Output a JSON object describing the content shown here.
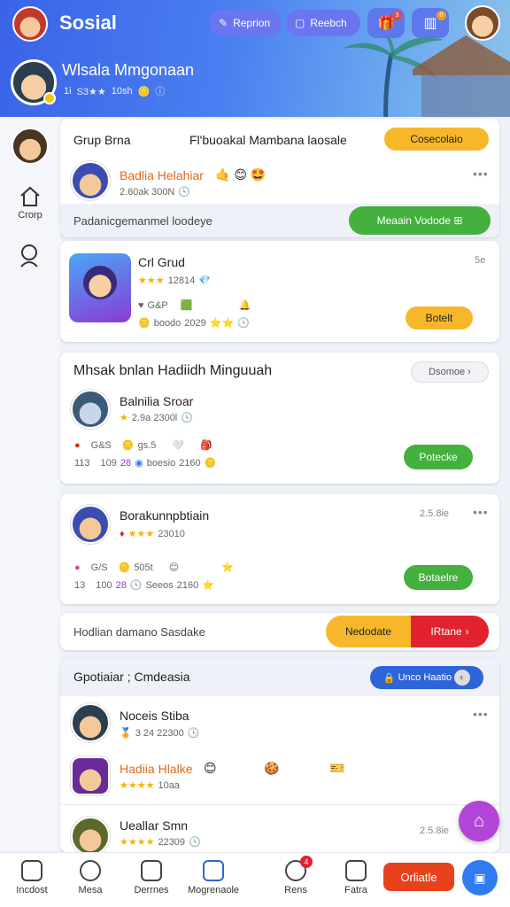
{
  "header": {
    "title": "Sosial",
    "pill_a": "Reprion",
    "pill_b": "Reebch",
    "badge_1": "3",
    "badge_2": "0",
    "profile_name": "Wlsala Mmgonaan",
    "profile_level": "1i",
    "profile_stats": "S3★★",
    "profile_points": "10sh"
  },
  "sidebar": {
    "home_label": "Crorp"
  },
  "card1": {
    "group_label": "Grup Brna",
    "description": "Fl'buoakal Mambana laosale",
    "action": "Cosecolaio",
    "user_name": "Badlia Helahiar",
    "user_meta": "2.60ak 300N",
    "footer_text": "Padanicgemanmel loodeye",
    "footer_button": "Meaain Vodode"
  },
  "card2": {
    "title": "Crl Grud",
    "stars": "★★★",
    "rating_text": "12814",
    "stat_1": "G&P",
    "stat_2": "boodo",
    "stat_3": "2029",
    "time": "5e",
    "button": "Botelt"
  },
  "card3": {
    "title": "Mhsak bnlan Hadiidh Minguuah",
    "action": "Dsomoe",
    "user_name": "Balnilia Sroar",
    "user_meta": "2.9a 2300l",
    "stat_1": "G&S",
    "stat_2": "gs.5",
    "stat_3": "113",
    "stat_4": "109",
    "stat_5": "28",
    "stat_6": "boesio",
    "stat_7": "2160",
    "button": "Potecke"
  },
  "card4": {
    "user_name": "Borakunnpbtiain",
    "time": "2.5.8ie",
    "user_meta": "23010",
    "stat_1": "G/S",
    "stat_2": "505t",
    "stat_3": "13",
    "stat_4": "100",
    "stat_5": "28",
    "stat_6": "Seeos",
    "stat_7": "2160",
    "button": "Botaelre"
  },
  "banner": {
    "text": "Hodlian damano Sasdake",
    "left_btn": "Nedodate",
    "right_btn": "IRtane"
  },
  "groups": {
    "title": "Gpotiaiar ; Cmdeasia",
    "action": "Unco Haatio",
    "items": [
      {
        "name": "Noceis Stiba",
        "meta": "3 24 22300",
        "time": ""
      },
      {
        "name": "Hadiia Hlalke",
        "meta": "10aa",
        "time": ""
      },
      {
        "name": "Ueallar Smn",
        "meta": "22309",
        "time": "2.5.8ie"
      }
    ]
  },
  "bottom_nav": {
    "items": [
      "Incdost",
      "Mesa",
      "Derrnes",
      "Mogrenaole",
      "Rens",
      "Fatra"
    ],
    "badge": "4",
    "cta": "Orliatle"
  },
  "colors": {
    "accent": "#3a63e8",
    "green": "#44b03d",
    "yellow": "#f6b82a",
    "red": "#e0232e",
    "purple": "#b245d8"
  }
}
